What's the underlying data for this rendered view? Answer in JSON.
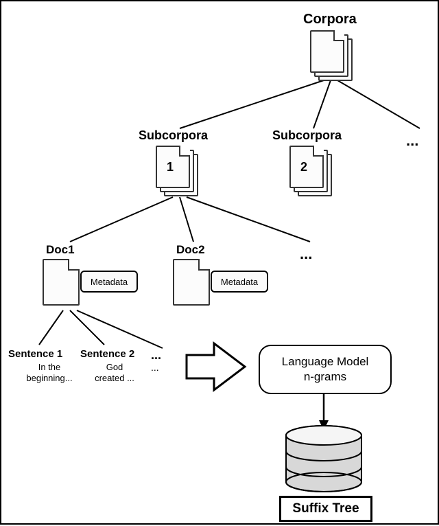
{
  "root": {
    "title": "Corpora"
  },
  "level2": {
    "item1": {
      "title": "Subcorpora",
      "num": "1"
    },
    "item2": {
      "title": "Subcorpora",
      "num": "2"
    },
    "more": "..."
  },
  "level3": {
    "doc1": {
      "title": "Doc1",
      "meta": "Metadata"
    },
    "doc2": {
      "title": "Doc2",
      "meta": "Metadata"
    },
    "more": "..."
  },
  "level4": {
    "s1": {
      "title": "Sentence 1",
      "text1": "In the",
      "text2": "beginning..."
    },
    "s2": {
      "title": "Sentence 2",
      "text1": "God",
      "text2": "created ..."
    },
    "more": "...",
    "more2": "..."
  },
  "langmodel": {
    "line1": "Language Model",
    "line2": "n-grams"
  },
  "suffix": {
    "label": "Suffix Tree"
  }
}
